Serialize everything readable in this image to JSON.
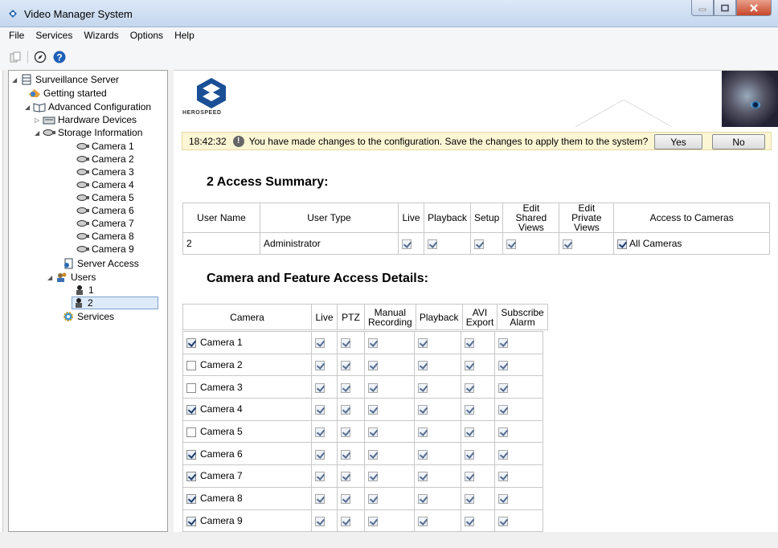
{
  "window": {
    "title": "Video Manager System"
  },
  "menu": [
    "File",
    "Services",
    "Wizards",
    "Options",
    "Help"
  ],
  "tree": {
    "root": "Surveillance Server",
    "getting_started": "Getting started",
    "advanced": "Advanced Configuration",
    "hardware": "Hardware Devices",
    "storage": "Storage Information",
    "cameras": [
      "Camera 1",
      "Camera 2",
      "Camera 3",
      "Camera 4",
      "Camera 5",
      "Camera 6",
      "Camera 7",
      "Camera 8",
      "Camera 9"
    ],
    "server_access": "Server Access",
    "users": "Users",
    "user_items": [
      "1",
      "2"
    ],
    "services": "Services"
  },
  "banner": {
    "logo_text": "HEROSPEED"
  },
  "notification": {
    "time": "18:42:32",
    "message": "You have made changes to the configuration. Save the changes to apply them to the system?",
    "yes_label": "Yes",
    "no_label": "No"
  },
  "access_summary": {
    "title": "2 Access Summary:",
    "headers": [
      "User Name",
      "User Type",
      "Live",
      "Playback",
      "Setup",
      "Edit Shared Views",
      "Edit Private Views",
      "Access to Cameras"
    ],
    "row": {
      "user_name": "2",
      "user_type": "Administrator",
      "live": true,
      "playback": true,
      "setup": true,
      "edit_shared": true,
      "edit_private": true,
      "all_cameras": true,
      "all_cameras_label": "All Cameras"
    }
  },
  "camera_access": {
    "title": "Camera and Feature Access Details:",
    "headers": [
      "Camera",
      "Live",
      "PTZ",
      "Manual Recording",
      "Playback",
      "AVI Export",
      "Subscribe Alarm"
    ],
    "rows": [
      {
        "camera": "Camera 1",
        "enabled": true
      },
      {
        "camera": "Camera 2",
        "enabled": false
      },
      {
        "camera": "Camera 3",
        "enabled": false
      },
      {
        "camera": "Camera 4",
        "enabled": true
      },
      {
        "camera": "Camera 5",
        "enabled": false
      },
      {
        "camera": "Camera 6",
        "enabled": true
      },
      {
        "camera": "Camera 7",
        "enabled": true
      },
      {
        "camera": "Camera 8",
        "enabled": true
      },
      {
        "camera": "Camera 9",
        "enabled": true
      }
    ]
  }
}
